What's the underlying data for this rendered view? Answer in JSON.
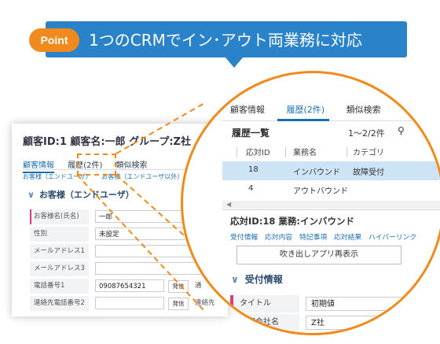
{
  "banner": {
    "badge": "Point",
    "text": "1つのCRMでイン･アウト両業務に対応"
  },
  "app": {
    "title": "顧客ID:1 顧客名:一郎 グループ:Z社",
    "tabs": [
      "顧客情報",
      "履歴(2件)",
      "類似検索"
    ],
    "subtabs": [
      "お客様（エンドユーザ）",
      "お客様（エンドユーザ以外）"
    ],
    "section": "お客様（エンドユーザ）",
    "fields": [
      {
        "label": "お客様名(氏名)",
        "value": "一郎"
      },
      {
        "label": "性別",
        "value": "未設定"
      },
      {
        "label": "メールアドレス1",
        "value": ""
      },
      {
        "label": "メールアドレス3",
        "value": ""
      },
      {
        "label": "電話番号1",
        "value": "09087654321",
        "button": "発信",
        "trail": "通"
      },
      {
        "label": "連絡先電話番号2",
        "value": "",
        "button": "発信",
        "trail": "連絡先"
      }
    ]
  },
  "zoom": {
    "tabs": [
      "顧客情報",
      "履歴(2件)",
      "類似検索"
    ],
    "history_title": "履歴一覧",
    "count": "1～2/2件",
    "columns": [
      "応対ID",
      "業務名",
      "カテゴリ"
    ],
    "rows": [
      {
        "id": "18",
        "name": "インバウンド",
        "category": "故障受付"
      },
      {
        "id": "4",
        "name": "アウトバウンド",
        "category": ""
      }
    ],
    "response_title": "応対ID:18 業務:インバウンド",
    "links": [
      "受付情報",
      "応対内容",
      "特記事項",
      "応対結果",
      "ハイパーリンク"
    ],
    "popout_button": "吹き出しアプリ再表示",
    "section": "受付情報",
    "fields": [
      {
        "label": "タイトル",
        "value": "初期値"
      },
      {
        "label": "顧客会社名",
        "value": "Z社"
      }
    ]
  },
  "colors": {
    "banner": "#2a82c9",
    "accent_orange": "#f18a1c",
    "link_blue": "#1a6fb3",
    "selected_row": "#cde4f6",
    "required_mark": "#d93b7a"
  }
}
